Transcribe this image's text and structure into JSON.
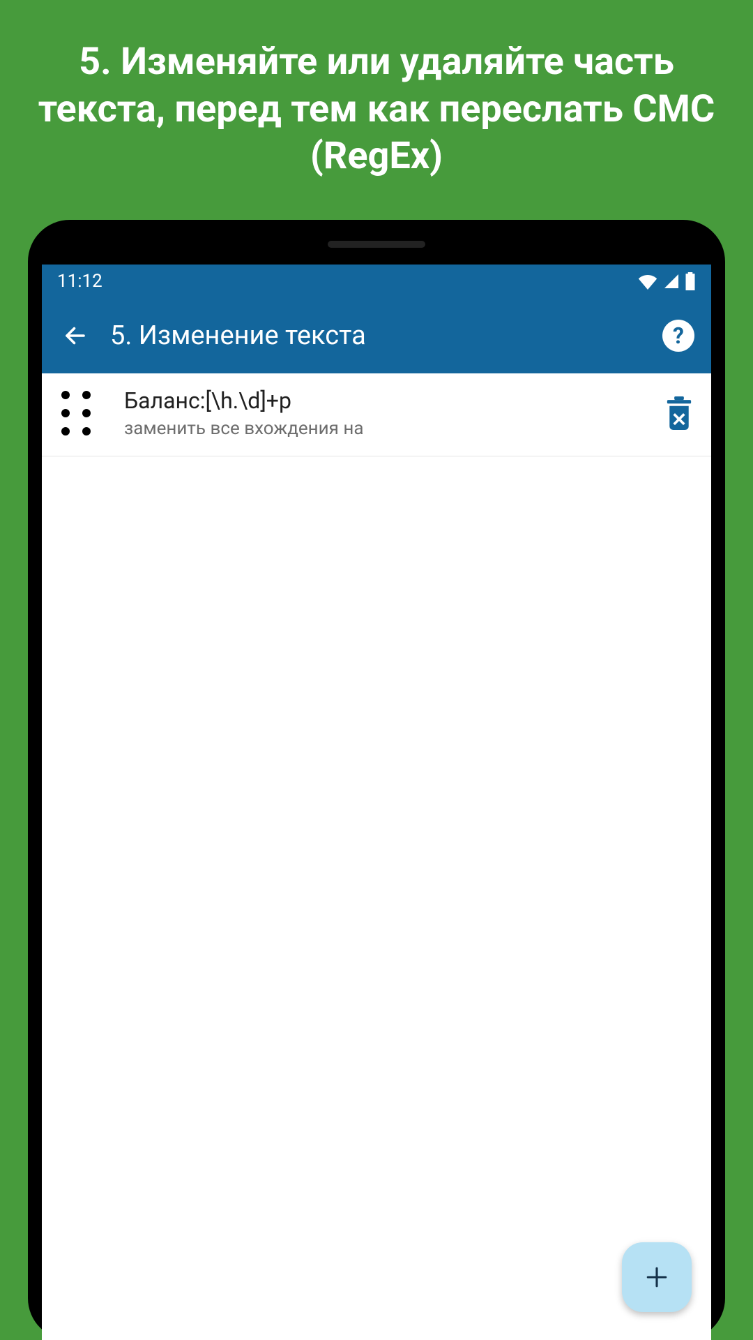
{
  "promo": {
    "heading": "5. Изменяйте или удаляйте часть текста, перед тем как переслать СМС (RegEx)"
  },
  "status_bar": {
    "time": "11:12"
  },
  "app_bar": {
    "title": "5. Изменение текста",
    "help_label": "?"
  },
  "rules": [
    {
      "pattern": "Баланс:[\\h.\\d]+р",
      "description": "заменить все вхождения на"
    }
  ],
  "fab": {
    "label": "+"
  }
}
